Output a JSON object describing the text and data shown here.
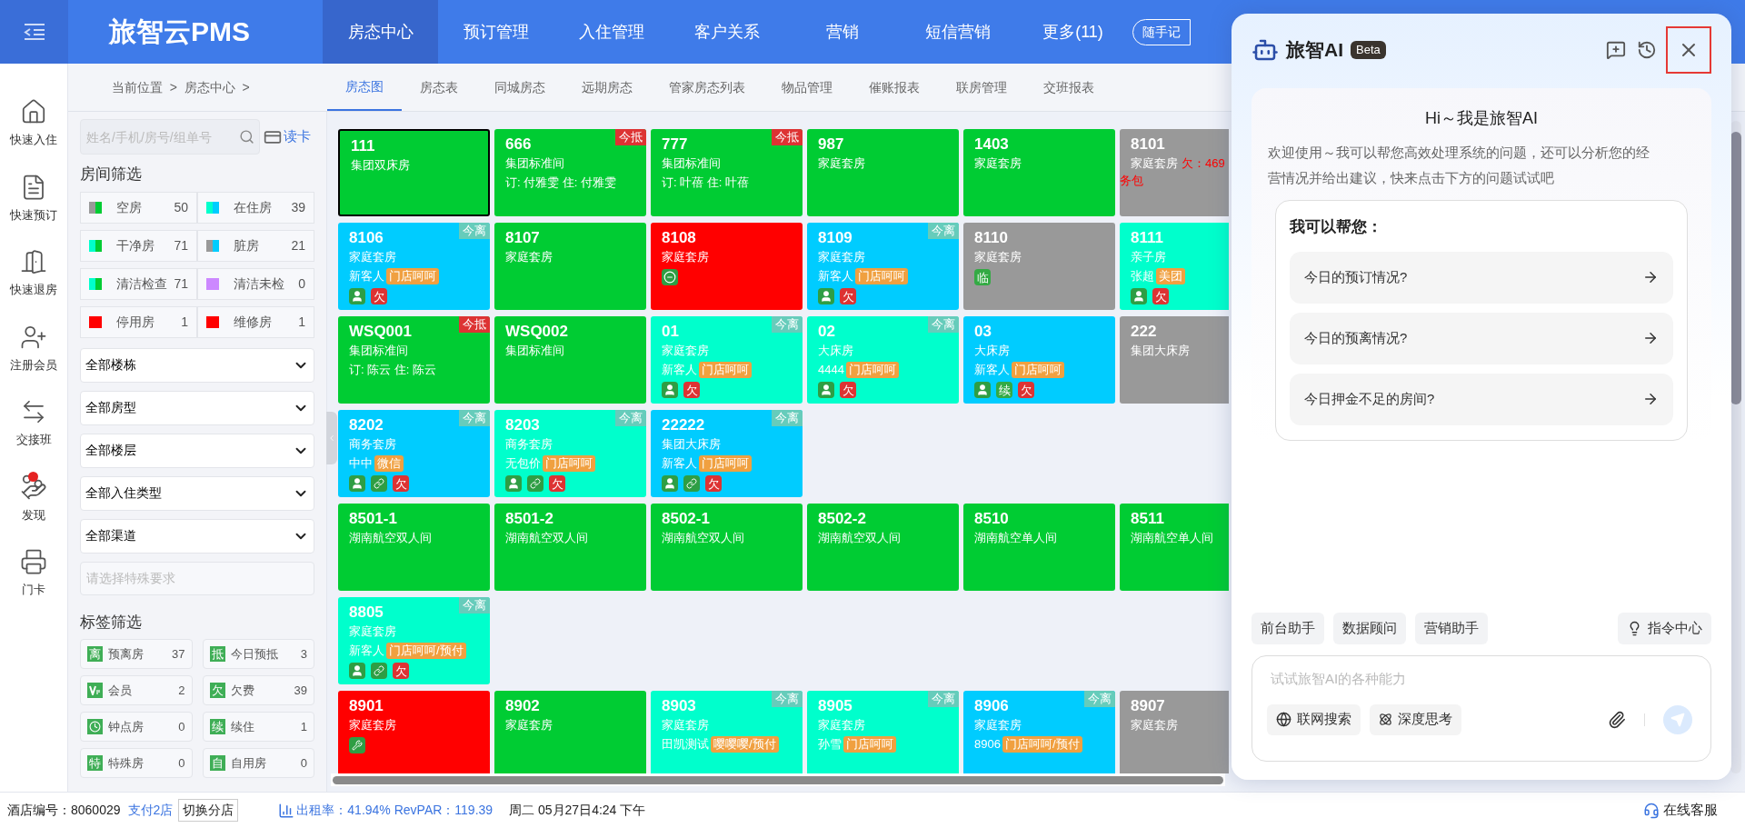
{
  "header": {
    "logo": "旅智云PMS",
    "nav": [
      {
        "label": "房态中心",
        "selected": true
      },
      {
        "label": "预订管理",
        "selected": false
      },
      {
        "label": "入住管理",
        "selected": false
      },
      {
        "label": "客户关系",
        "selected": false
      },
      {
        "label": "营销",
        "selected": false
      },
      {
        "label": "短信营销",
        "selected": false
      },
      {
        "label": "更多(11)",
        "selected": false
      }
    ],
    "memo_button": "随手记"
  },
  "sidebar": {
    "items": [
      {
        "label": "快速入住",
        "badge": false
      },
      {
        "label": "快速预订",
        "badge": false
      },
      {
        "label": "快速退房",
        "badge": false
      },
      {
        "label": "注册会员",
        "badge": false
      },
      {
        "label": "交接班",
        "badge": false
      },
      {
        "label": "发现",
        "badge": true
      },
      {
        "label": "门卡",
        "badge": false
      }
    ]
  },
  "breadcrumb": "当前位置  >  房态中心  >",
  "tabs": [
    {
      "label": "房态图",
      "selected": true
    },
    {
      "label": "房态表",
      "selected": false
    },
    {
      "label": "同城房态",
      "selected": false
    },
    {
      "label": "远期房态",
      "selected": false
    },
    {
      "label": "管家房态列表",
      "selected": false
    },
    {
      "label": "物品管理",
      "selected": false
    },
    {
      "label": "催账报表",
      "selected": false
    },
    {
      "label": "联房管理",
      "selected": false
    },
    {
      "label": "交班报表",
      "selected": false
    }
  ],
  "filters": {
    "search": {
      "placeholder": "姓名/手机/房号/组单号"
    },
    "read_card": "读卡",
    "room_heading": "房间筛选",
    "room_status": [
      {
        "label": "空房",
        "count": "50",
        "swatch": [
          {
            "color": "#999999"
          },
          {
            "color": "#00cc33"
          }
        ]
      },
      {
        "label": "在住房",
        "count": "39",
        "swatch": [
          {
            "color": "#00ffcc"
          },
          {
            "color": "#00ccff"
          }
        ]
      },
      {
        "label": "干净房",
        "count": "71",
        "swatch": [
          {
            "color": "#00ffcc"
          },
          {
            "color": "#00cc33"
          }
        ]
      },
      {
        "label": "脏房",
        "count": "21",
        "swatch": [
          {
            "color": "#999999"
          },
          {
            "color": "#00ccff"
          }
        ]
      },
      {
        "label": "清洁检查",
        "count": "71",
        "swatch": [
          {
            "color": "#00ffcc"
          },
          {
            "color": "#00cc33"
          }
        ]
      },
      {
        "label": "清洁未检",
        "count": "0",
        "swatch": [
          {
            "color": "#cc88ff"
          },
          {
            "color": "#cc88ff"
          }
        ]
      },
      {
        "label": "停用房",
        "count": "1",
        "swatch": [
          {
            "color": "#ff0000"
          },
          {
            "color": "#ff0000"
          }
        ]
      },
      {
        "label": "维修房",
        "count": "1",
        "swatch": [
          {
            "color": "#ff0000"
          },
          {
            "color": "#ff0000"
          }
        ]
      }
    ],
    "dropdowns": [
      "全部楼栋",
      "全部房型",
      "全部楼层",
      "全部入住类型",
      "全部渠道"
    ],
    "special": {
      "placeholder": "请选择特殊要求"
    },
    "tag_heading": "标签筛选",
    "tags": [
      {
        "kind": "glyph",
        "glyph": "离",
        "label": "预离房",
        "count": "37"
      },
      {
        "kind": "glyph",
        "glyph": "抵",
        "label": "今日预抵",
        "count": "3"
      },
      {
        "kind": "vip",
        "label": "会员",
        "count": "2"
      },
      {
        "kind": "glyph",
        "glyph": "欠",
        "label": "欠费",
        "count": "39"
      },
      {
        "kind": "clock",
        "label": "钟点房",
        "count": "0"
      },
      {
        "kind": "glyph",
        "glyph": "续",
        "label": "续住",
        "count": "1"
      },
      {
        "kind": "glyph",
        "glyph": "特",
        "label": "特殊房",
        "count": "0"
      },
      {
        "kind": "glyph",
        "glyph": "自",
        "label": "自用房",
        "count": "0"
      }
    ]
  },
  "floors": [
    {
      "rooms": [
        {
          "number": "111",
          "type": "集团双床房",
          "color": "#00cc33",
          "selected": true
        },
        {
          "number": "666",
          "type": "集团标准间",
          "color": "#00cc33",
          "selected": false,
          "tag": {
            "text": "今抵",
            "color": "#dd3333"
          },
          "line": "订: 付雅雯 住: 付雅雯"
        },
        {
          "number": "777",
          "type": "集团标准间",
          "color": "#00cc33",
          "selected": false,
          "tag": {
            "text": "今抵",
            "color": "#dd3333"
          },
          "line": "订: 叶蓓 住: 叶蓓"
        },
        {
          "number": "987",
          "type": "家庭套房",
          "color": "#00cc33",
          "selected": false
        },
        {
          "number": "1403",
          "type": "家庭套房",
          "color": "#00cc33",
          "selected": false
        },
        {
          "number": "8101",
          "type": "家庭套房",
          "color": "#999999",
          "selected": false,
          "note": "欠：469",
          "note_2": "务包"
        }
      ]
    },
    {
      "rooms": [
        {
          "number": "8106",
          "type": "家庭套房",
          "color": "#00ccff",
          "selected": false,
          "tag": {
            "text": "今离",
            "color": "#66ccbb"
          },
          "guest": "新客人",
          "channel": "门店呵呵",
          "icons": [
            {
              "kind": "person"
            },
            {
              "kind": "mark",
              "text": "欠",
              "color": "#dd3333"
            }
          ]
        },
        {
          "number": "8107",
          "type": "家庭套房",
          "color": "#00cc33",
          "selected": false
        },
        {
          "number": "8108",
          "type": "家庭套房",
          "color": "#ff0000",
          "selected": false,
          "icons": [
            {
              "kind": "stop"
            }
          ]
        },
        {
          "number": "8109",
          "type": "家庭套房",
          "color": "#00ccff",
          "selected": false,
          "tag": {
            "text": "今离",
            "color": "#66ccbb"
          },
          "guest": "新客人",
          "channel": "门店呵呵",
          "icons": [
            {
              "kind": "person"
            },
            {
              "kind": "mark",
              "text": "欠",
              "color": "#dd3333"
            }
          ]
        },
        {
          "number": "8110",
          "type": "家庭套房",
          "color": "#999999",
          "selected": false,
          "icons": [
            {
              "kind": "mark",
              "text": "临",
              "color": "#33aa44"
            }
          ]
        },
        {
          "number": "8111",
          "type": "亲子房",
          "color": "#00ffcc",
          "selected": false,
          "guest": "张超",
          "channel": "美团",
          "icons": [
            {
              "kind": "person"
            },
            {
              "kind": "mark",
              "text": "欠",
              "color": "#dd3333"
            }
          ]
        }
      ]
    },
    {
      "rooms": [
        {
          "number": "WSQ001",
          "type": "集团标准间",
          "color": "#00cc33",
          "selected": false,
          "tag": {
            "text": "今抵",
            "color": "#dd3333"
          },
          "line": "订: 陈云 住: 陈云"
        },
        {
          "number": "WSQ002",
          "type": "集团标准间",
          "color": "#00cc33",
          "selected": false
        },
        {
          "number": "01",
          "type": "家庭套房",
          "color": "#00ffcc",
          "selected": false,
          "tag": {
            "text": "今离",
            "color": "#66ccbb"
          },
          "guest": "新客人",
          "channel": "门店呵呵",
          "icons": [
            {
              "kind": "person"
            },
            {
              "kind": "mark",
              "text": "欠",
              "color": "#dd3333"
            }
          ]
        },
        {
          "number": "02",
          "type": "大床房",
          "color": "#00ffcc",
          "selected": false,
          "tag": {
            "text": "今离",
            "color": "#66ccbb"
          },
          "guest": "4444",
          "channel": "门店呵呵",
          "icons": [
            {
              "kind": "person"
            },
            {
              "kind": "mark",
              "text": "欠",
              "color": "#dd3333"
            }
          ]
        },
        {
          "number": "03",
          "type": "大床房",
          "color": "#00ccff",
          "selected": false,
          "guest": "新客人",
          "channel": "门店呵呵",
          "icons": [
            {
              "kind": "person"
            },
            {
              "kind": "mark",
              "text": "续",
              "color": "#33aa44"
            },
            {
              "kind": "mark",
              "text": "欠",
              "color": "#dd3333"
            }
          ]
        },
        {
          "number": "222",
          "type": "集团大床房",
          "color": "#999999",
          "selected": false
        }
      ]
    },
    {
      "rooms": [
        {
          "number": "8202",
          "type": "商务套房",
          "color": "#00ccff",
          "selected": false,
          "tag": {
            "text": "今离",
            "color": "#66ccbb"
          },
          "guest": "中中",
          "channel": "微信",
          "icons": [
            {
              "kind": "person"
            },
            {
              "kind": "link"
            },
            {
              "kind": "mark",
              "text": "欠",
              "color": "#dd3333"
            }
          ]
        },
        {
          "number": "8203",
          "type": "商务套房",
          "color": "#00ffcc",
          "selected": false,
          "tag": {
            "text": "今离",
            "color": "#66ccbb"
          },
          "guest": "无包价",
          "channel": "门店呵呵",
          "icons": [
            {
              "kind": "person"
            },
            {
              "kind": "link"
            },
            {
              "kind": "mark",
              "text": "欠",
              "color": "#dd3333"
            }
          ]
        },
        {
          "number": "22222",
          "type": "集团大床房",
          "color": "#00ccff",
          "selected": false,
          "tag": {
            "text": "今离",
            "color": "#66ccbb"
          },
          "guest": "新客人",
          "channel": "门店呵呵",
          "icons": [
            {
              "kind": "person"
            },
            {
              "kind": "link"
            },
            {
              "kind": "mark",
              "text": "欠",
              "color": "#dd3333"
            }
          ]
        }
      ]
    },
    {
      "rooms": [
        {
          "number": "8501-1",
          "type": "湖南航空双人间",
          "color": "#00cc33",
          "selected": false
        },
        {
          "number": "8501-2",
          "type": "湖南航空双人间",
          "color": "#00cc33",
          "selected": false
        },
        {
          "number": "8502-1",
          "type": "湖南航空双人间",
          "color": "#00cc33",
          "selected": false
        },
        {
          "number": "8502-2",
          "type": "湖南航空双人间",
          "color": "#00cc33",
          "selected": false
        },
        {
          "number": "8510",
          "type": "湖南航空单人间",
          "color": "#00cc33",
          "selected": false
        },
        {
          "number": "8511",
          "type": "湖南航空单人间",
          "color": "#00cc33",
          "selected": false
        }
      ]
    },
    {
      "rooms": [
        {
          "number": "8805",
          "type": "家庭套房",
          "color": "#00ffcc",
          "selected": false,
          "tag": {
            "text": "今离",
            "color": "#66ccbb"
          },
          "guest": "新客人",
          "channel": "门店呵呵/预付",
          "icons": [
            {
              "kind": "person"
            },
            {
              "kind": "link"
            },
            {
              "kind": "mark",
              "text": "欠",
              "color": "#dd3333"
            }
          ]
        }
      ]
    },
    {
      "rooms": [
        {
          "number": "8901",
          "type": "家庭套房",
          "color": "#ff0000",
          "selected": false,
          "icons": [
            {
              "kind": "wrench"
            }
          ]
        },
        {
          "number": "8902",
          "type": "家庭套房",
          "color": "#00cc33",
          "selected": false
        },
        {
          "number": "8903",
          "type": "家庭套房",
          "color": "#00ffcc",
          "selected": false,
          "tag": {
            "text": "今离",
            "color": "#66ccbb"
          },
          "guest": "田凯测试",
          "channel": "嘤嘤嘤/预付"
        },
        {
          "number": "8905",
          "type": "家庭套房",
          "color": "#00ffcc",
          "selected": false,
          "tag": {
            "text": "今离",
            "color": "#66ccbb"
          },
          "guest": "孙雪",
          "channel": "门店呵呵"
        },
        {
          "number": "8906",
          "type": "家庭套房",
          "color": "#00ccff",
          "selected": false,
          "tag": {
            "text": "今离",
            "color": "#66ccbb"
          },
          "guest": "8906",
          "channel": "门店呵呵/预付"
        },
        {
          "number": "8907",
          "type": "家庭套房",
          "color": "#999999",
          "selected": false
        }
      ]
    }
  ],
  "ai_panel": {
    "title": "旅智AI",
    "badge": "Beta",
    "greeting": "Hi～我是旅智AI",
    "intro": "欢迎使用～我可以帮您高效处理系统的问题，还可以分析您的经营情况并给出建议，快来点击下方的问题试试吧",
    "help_heading": "我可以帮您：",
    "questions": [
      "今日的预订情况?",
      "今日的预离情况?",
      "今日押金不足的房间?"
    ],
    "assistants": [
      "前台助手",
      "数据顾问",
      "营销助手"
    ],
    "command_center": "指令中心",
    "input": {
      "placeholder": "试试旅智AI的各种能力"
    },
    "options": [
      "联网搜索",
      "深度思考"
    ]
  },
  "status_bar": {
    "hotel_label": "酒店编号：",
    "hotel_id": "8060029",
    "branch": "支付2店",
    "switch": "切换分店",
    "occupancy": "出租率：41.94% RevPAR：119.39",
    "datetime": "周二 05月27日4:24 下午",
    "support": "在线客服"
  }
}
